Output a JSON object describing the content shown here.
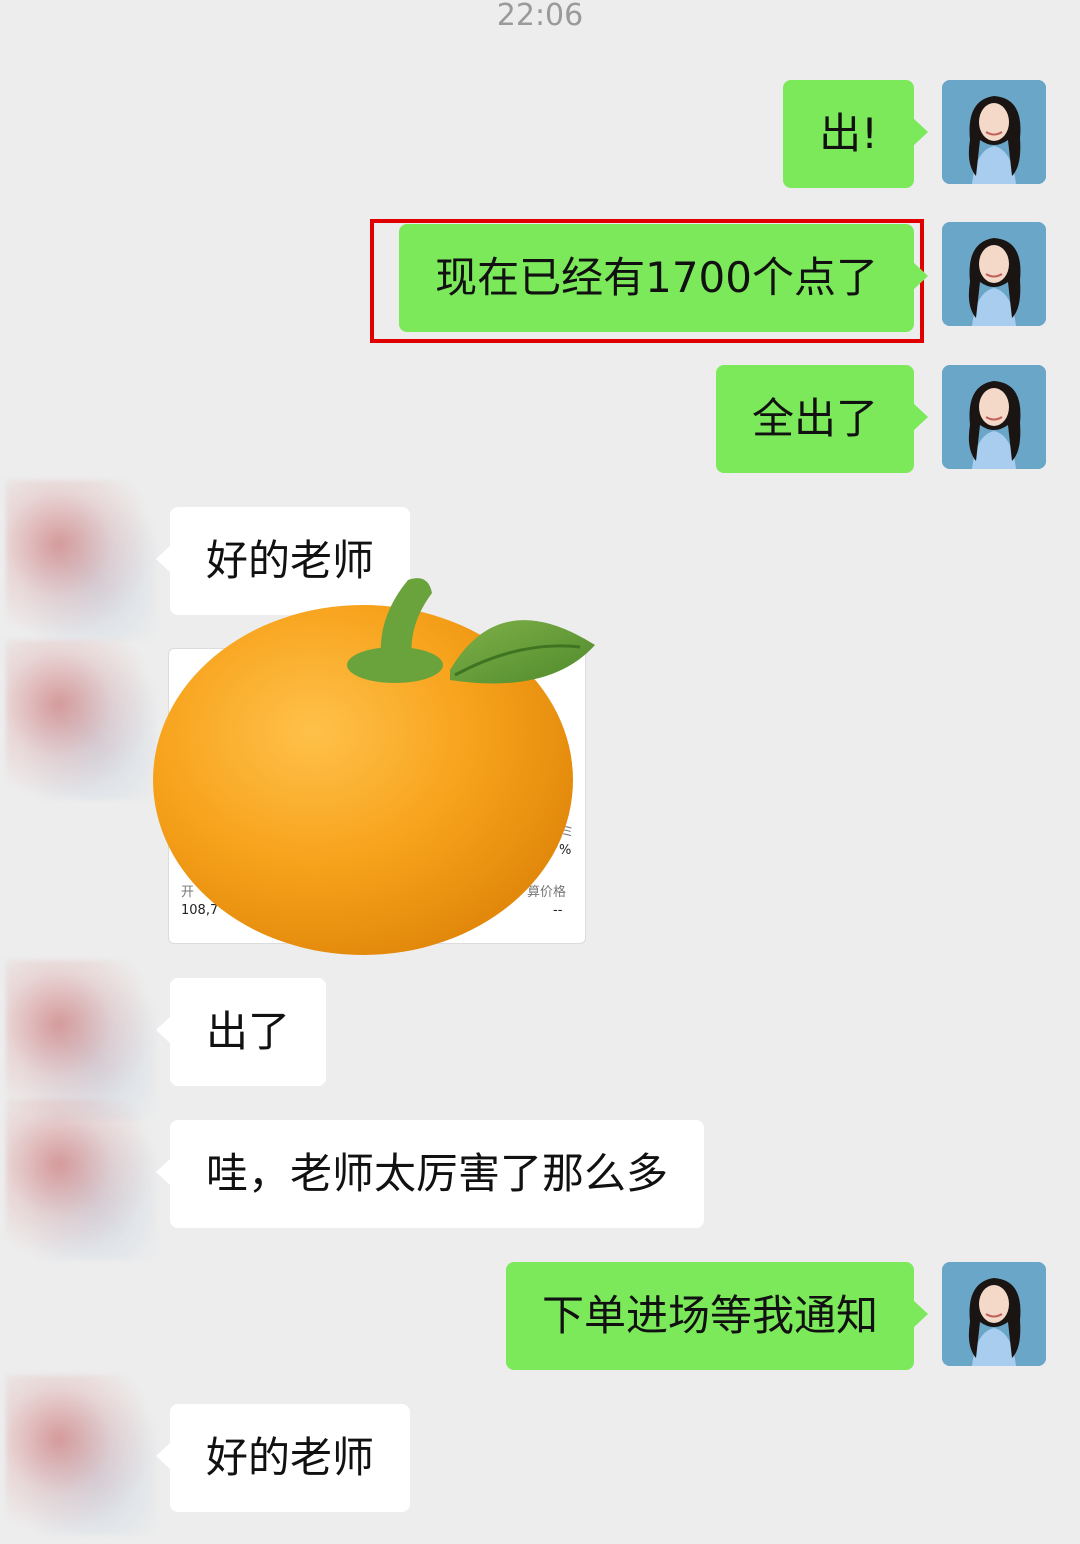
{
  "timestamp": "22:06",
  "messages": [
    {
      "side": "me",
      "text": "出!"
    },
    {
      "side": "me",
      "text": "现在已经有1700个点了"
    },
    {
      "side": "me",
      "text": "全出了"
    },
    {
      "side": "other",
      "text": "好的老师"
    },
    {
      "side": "other",
      "text": "出了"
    },
    {
      "side": "other",
      "text": "哇，老师太厉害了那么多"
    },
    {
      "side": "me",
      "text": "下单进场等我通知"
    },
    {
      "side": "other",
      "text": "好的老师"
    }
  ],
  "card": {
    "label_left": "开",
    "value_left": "108,7",
    "label_right": "算价格",
    "value_right": "--",
    "percent": "%",
    "tail": "ミ"
  },
  "icons": {
    "avatar_me": "woman-portrait-avatar",
    "avatar_other": "blurred-avatar",
    "sticker": "orange-sticker"
  },
  "colors": {
    "background": "#ededed",
    "my_bubble": "#7be95a",
    "other_bubble": "#ffffff",
    "highlight_border": "#e00000"
  }
}
